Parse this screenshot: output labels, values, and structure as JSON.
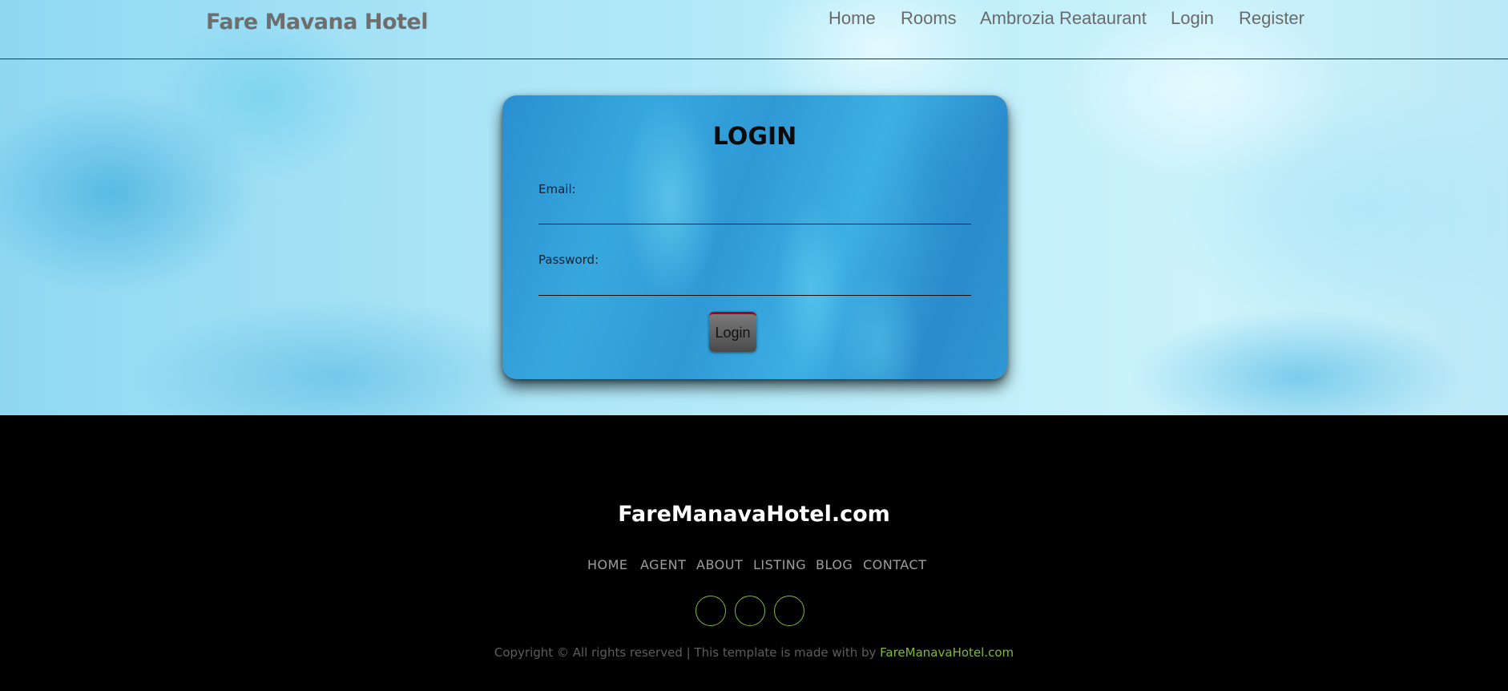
{
  "header": {
    "brand": "Fare Mavana Hotel",
    "nav": [
      "Home",
      "Rooms",
      "Ambrozia Reataurant",
      "Login",
      "Register"
    ]
  },
  "login_form": {
    "title": "LOGIN",
    "email_label": "Email:",
    "email_value": "",
    "password_label": "Password:",
    "password_value": "",
    "submit_label": "Login"
  },
  "footer": {
    "brand": "FareManavaHotel.com",
    "links": [
      "HOME",
      "AGENT",
      "ABOUT",
      "LISTING",
      "BLOG",
      "CONTACT"
    ],
    "social_icons": [
      "social-icon",
      "social-icon",
      "social-icon"
    ],
    "copyright_text": "Copyright © All rights reserved | This template is made with by",
    "copyright_link": "FareManavaHotel.com"
  },
  "colors": {
    "accent_green": "#7dbb3a",
    "nav_text": "#6a6a6a",
    "button_top_border": "#b00010"
  }
}
